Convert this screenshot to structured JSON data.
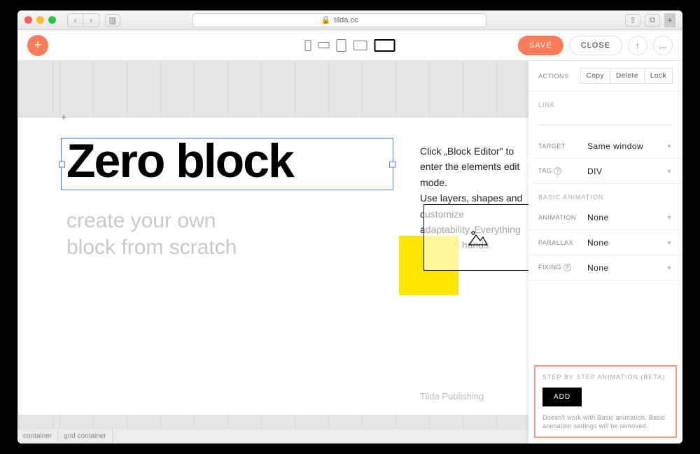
{
  "browser": {
    "url": "tilda.cc"
  },
  "toolbar": {
    "save": "SAVE",
    "close": "CLOSE",
    "undo_glyph": "↑",
    "more": "…"
  },
  "canvas": {
    "heading": "Zero block",
    "subheading_line1": "create your own",
    "subheading_line2": "block from scratch",
    "body_line1": "Click „Block Editor\" to enter the elements edit mode.",
    "body_line2": "Use layers, shapes and customize",
    "body_line3": "adaptability. Everything is in your hands.",
    "credit": "Tilda Publishing"
  },
  "statusbar": {
    "item1": "container",
    "item2": "grid container"
  },
  "panel": {
    "actions_label": "ACTIONS",
    "copy": "Copy",
    "delete": "Delete",
    "lock": "Lock",
    "link_label": "LINK",
    "target_label": "TARGET",
    "target_value": "Same window",
    "tag_label": "TAG",
    "tag_value": "DIV",
    "basic_anim_header": "BASIC ANIMATION",
    "animation_label": "ANIMATION",
    "animation_value": "None",
    "parallax_label": "PARALLAX",
    "parallax_value": "None",
    "fixing_label": "FIXING",
    "fixing_value": "None",
    "step_header": "STEP BY STEP ANIMATION (BETA)",
    "add_btn": "ADD",
    "step_note": "Doesn't work with Basic animation. Basic animation settings will be removed."
  }
}
